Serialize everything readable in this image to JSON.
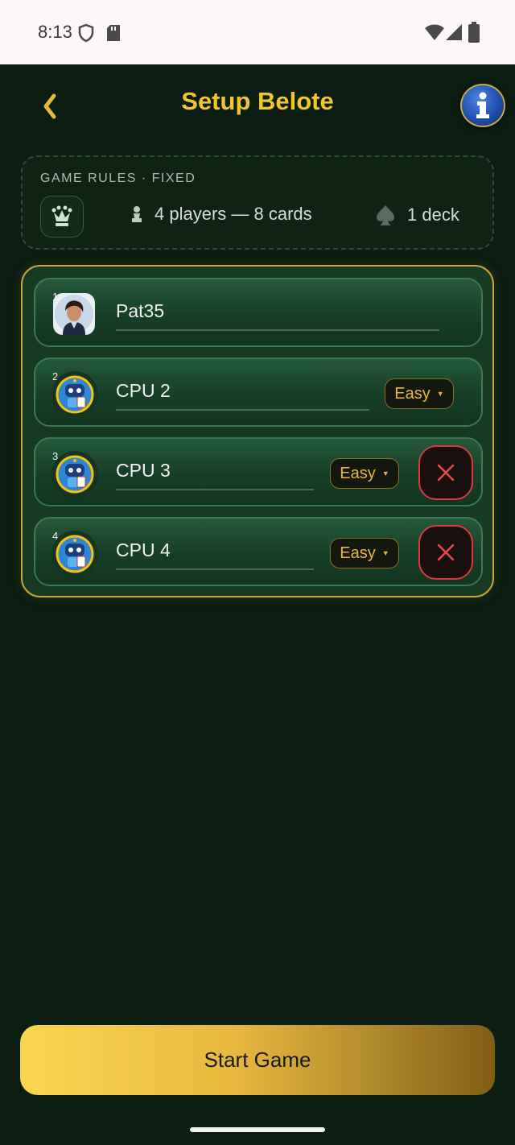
{
  "status_bar": {
    "time": "8:13",
    "icons": [
      "shield-icon",
      "sd-card-icon",
      "wifi-icon",
      "signal-icon",
      "battery-icon"
    ]
  },
  "header": {
    "title": "Setup Belote",
    "back_icon": "chevron-left-icon",
    "info_icon": "info-icon"
  },
  "rules": {
    "label": "GAME RULES · FIXED",
    "crown_icon": "chess-queen-icon",
    "players_text": "4 players — 8 cards",
    "deck_text": "1 deck"
  },
  "players": [
    {
      "number": "1",
      "name": "Pat35",
      "type": "human"
    },
    {
      "number": "2",
      "name": "CPU 2",
      "type": "cpu",
      "difficulty": "Easy"
    },
    {
      "number": "3",
      "name": "CPU 3",
      "type": "cpu",
      "difficulty": "Easy"
    },
    {
      "number": "4",
      "name": "CPU 4",
      "type": "cpu",
      "difficulty": "Easy"
    }
  ],
  "start_button": {
    "label": "Start Game"
  },
  "colors": {
    "background": "#0b1c10",
    "accent_gold": "#f2c52c",
    "remove_red": "#d83b3b",
    "row_border": "#3a7a4e"
  }
}
